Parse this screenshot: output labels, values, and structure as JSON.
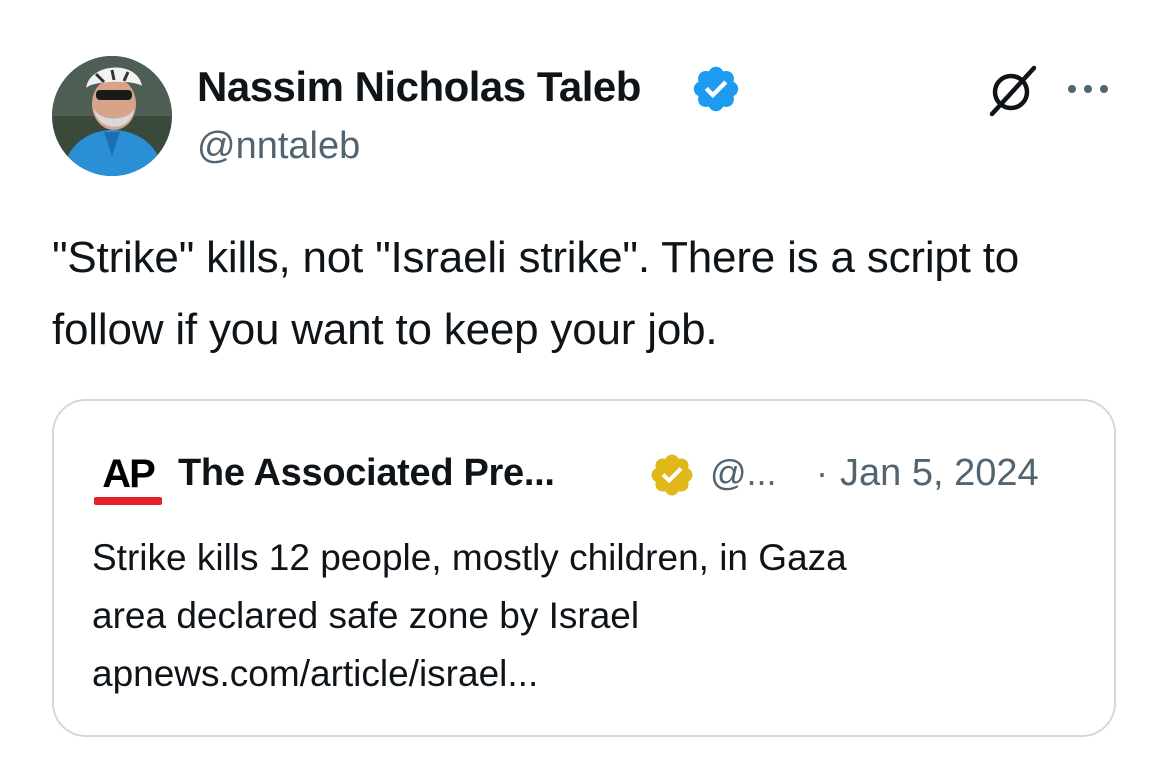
{
  "tweet": {
    "author": {
      "display_name": "Nassim Nicholas Taleb",
      "handle": "@nntaleb",
      "verified_badge": "blue-check-icon"
    },
    "text": "\"Strike\" kills, not \"Israeli strike\". There is a script to follow if you want to keep your job.",
    "actions": {
      "grok_icon": "grok-icon",
      "more_icon": "more-horizontal-icon"
    }
  },
  "quoted_tweet": {
    "author": {
      "display_name": "The Associated Pre...",
      "handle": "@...",
      "logo_text": "AP",
      "verified_badge": "gold-check-icon"
    },
    "separator": "·",
    "date": "Jan 5, 2024",
    "text_lines": [
      "Strike kills 12 people, mostly children, in Gaza",
      "area declared safe zone by Israel",
      "apnews.com/article/israel..."
    ]
  },
  "colors": {
    "text": "#0f1419",
    "secondary": "#536471",
    "verified_blue": "#1d9bf0",
    "verified_gold": "#e2b719",
    "ap_red": "#e4202a",
    "border": "#cfd9de"
  }
}
